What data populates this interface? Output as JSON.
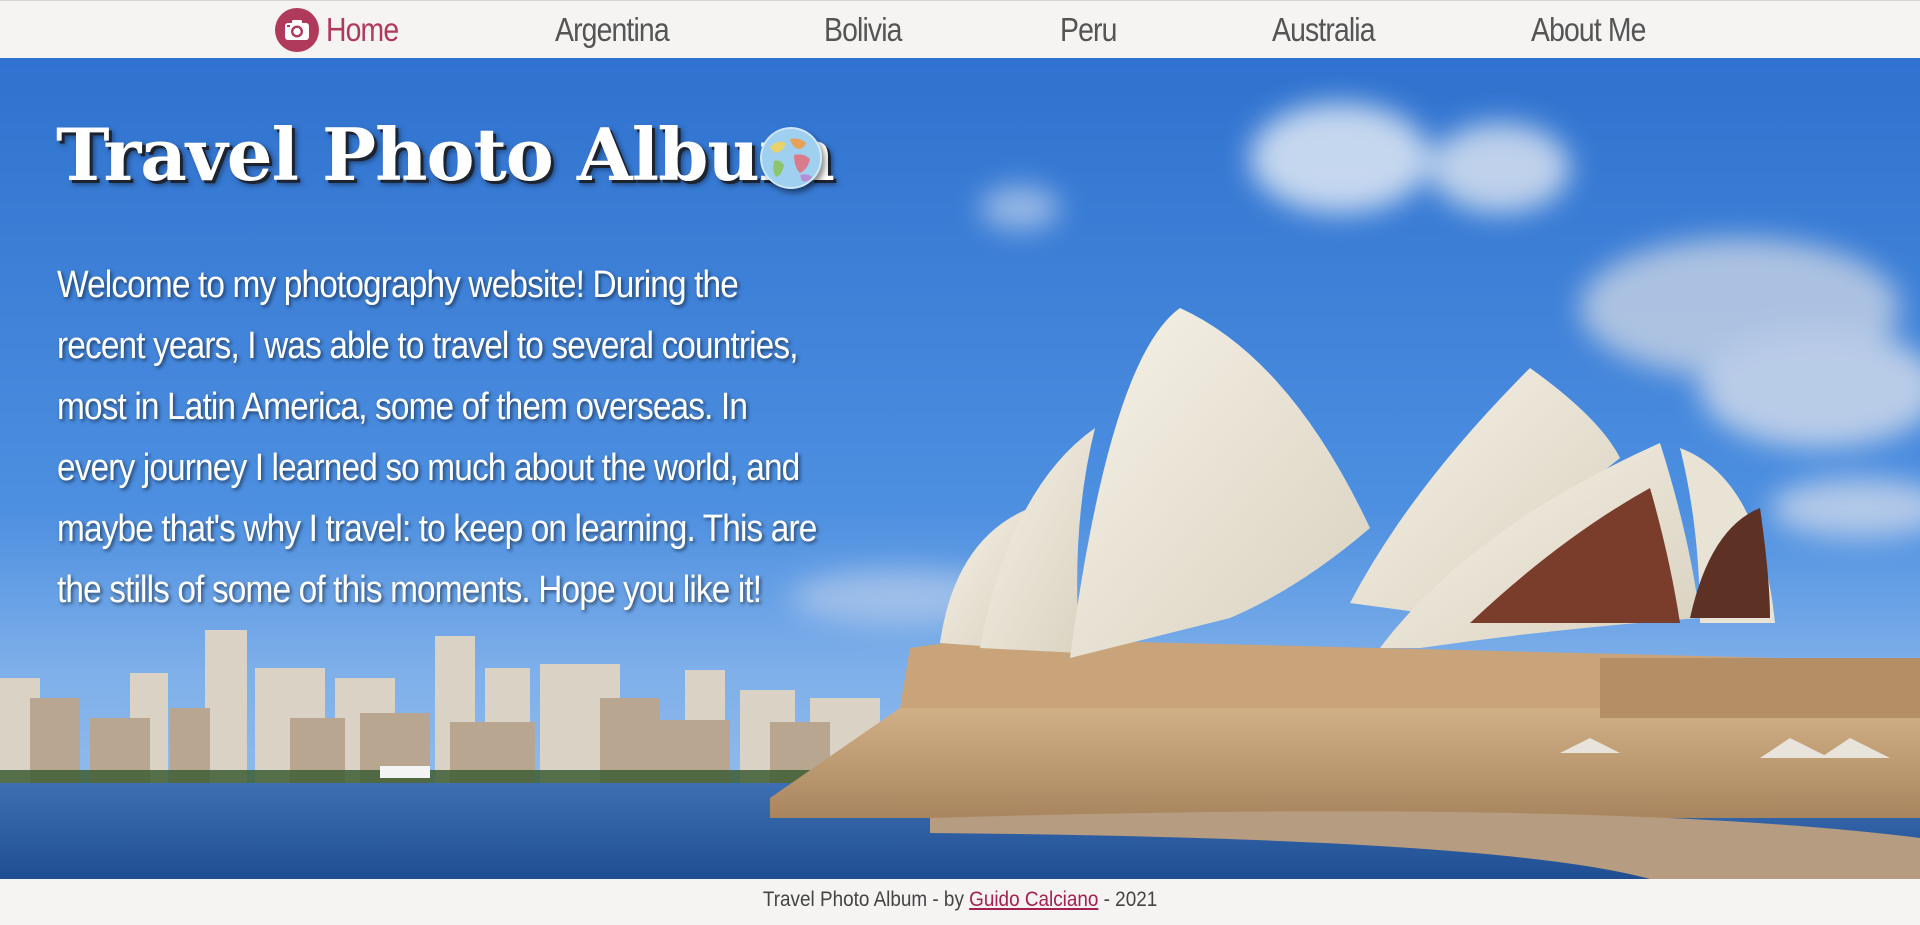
{
  "nav": {
    "items": [
      {
        "label": "Home",
        "active": true
      },
      {
        "label": "Argentina"
      },
      {
        "label": "Bolivia"
      },
      {
        "label": "Peru"
      },
      {
        "label": "Australia"
      },
      {
        "label": "About Me"
      }
    ],
    "home_icon": "camera-icon",
    "accent_color": "#b03a5b"
  },
  "hero": {
    "title": "Travel Photo Album",
    "title_icon": "globe-icon",
    "intro": "Welcome to my photography website! During the recent years, I was able to travel to several countries, most in Latin America, some of them overseas. In every journey I learned so much about the world, and maybe that's why I travel: to keep on learning. This are the stills of some of this moments. Hope you like it!"
  },
  "footer": {
    "prefix": "Travel Photo Album  - by ",
    "author": "Guido Calciano",
    "suffix": " -  2021",
    "link_color": "#a3204f"
  }
}
